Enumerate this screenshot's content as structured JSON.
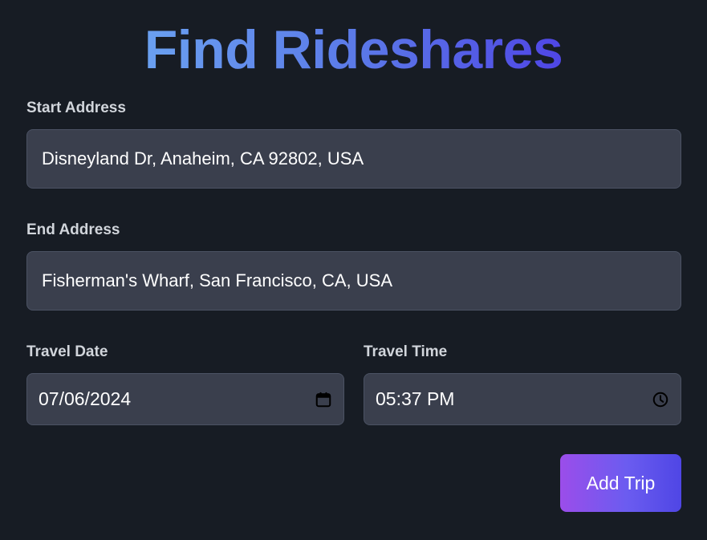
{
  "header": {
    "title": "Find Rideshares"
  },
  "form": {
    "start_address": {
      "label": "Start Address",
      "value": "Disneyland Dr, Anaheim, CA 92802, USA"
    },
    "end_address": {
      "label": "End Address",
      "value": "Fisherman's Wharf, San Francisco, CA, USA"
    },
    "travel_date": {
      "label": "Travel Date",
      "value": "07/06/2024",
      "icon": "calendar-icon"
    },
    "travel_time": {
      "label": "Travel Time",
      "value": "05:37 PM",
      "icon": "clock-icon"
    },
    "submit_label": "Add Trip"
  },
  "colors": {
    "background": "#171c24",
    "field_background": "#3a3f4d",
    "title_gradient": [
      "#6aa0f0",
      "#4f46e5"
    ],
    "button_gradient": [
      "#9b4dea",
      "#4f46e5"
    ]
  }
}
